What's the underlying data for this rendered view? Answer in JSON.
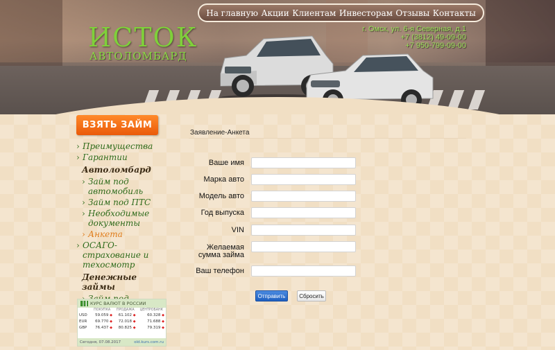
{
  "brand": {
    "name": "ИСТОК",
    "subtitle": "АВТОЛОМБАРД"
  },
  "nav": {
    "items": [
      "На главную",
      "Акции",
      "Клиентам",
      "Инвесторам",
      "Отзывы",
      "Контакты"
    ]
  },
  "contacts": {
    "address": "г. Омск, ул. 6-я Северная, д.1",
    "phone1": "+7 (3812) 49-09-00",
    "phone2": "+7 950-799-09-00"
  },
  "sidebar": {
    "cta": "ВЗЯТЬ ЗАЙМ",
    "menu": {
      "advantages": "Преимущества",
      "guarantees": "Гарантии",
      "autolombard_head": "Автоломбард",
      "loan_car": "Займ под автомобиль",
      "loan_pts": "Займ под ПТС",
      "documents": "Необходимые документы",
      "application": "Анкета",
      "osago": "ОСАГО-страхование и техосмотр",
      "money_loans_head": "Денежные займы",
      "loan_realty": "Займ под недвижимость"
    }
  },
  "currency": {
    "title": "КУРС ВАЛЮТ В РОССИИ",
    "columns": [
      "",
      "ПОКУПКА",
      "ПРОДАЖА",
      "ЦЕНТРОБАНК"
    ],
    "rows": [
      {
        "code": "USD",
        "buy": "59.059",
        "sell": "61.102",
        "cb": "60.328"
      },
      {
        "code": "EUR",
        "buy": "69.770",
        "sell": "72.018",
        "cb": "71.688"
      },
      {
        "code": "GBP",
        "buy": "76.437",
        "sell": "80.825",
        "cb": "79.319"
      }
    ],
    "date": "Сегодня, 07.08.2017",
    "source": "old.kurs.com.ru"
  },
  "form": {
    "page_title": "Заявление-Анкета",
    "fields": {
      "name": "Ваше имя",
      "brand": "Марка авто",
      "model": "Модель авто",
      "year": "Год выпуска",
      "vin": "VIN",
      "amount_line1": "Желаемая",
      "amount_line2": "сумма займа",
      "phone": "Ваш телефон"
    },
    "submit": "Отправить",
    "reset": "Сбросить"
  }
}
